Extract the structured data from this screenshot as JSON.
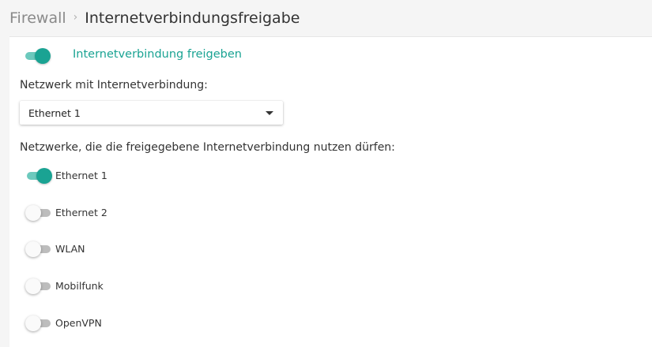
{
  "breadcrumb": {
    "parent": "Firewall",
    "separator": "›",
    "current": "Internetverbindungsfreigabe"
  },
  "sharing": {
    "toggle_label": "Internetverbindung freigeben",
    "enabled": true
  },
  "source_network": {
    "label": "Netzwerk mit Internetverbindung:",
    "selected": "Ethernet 1"
  },
  "allowed_networks": {
    "label": "Netzwerke, die die freigegebene Internetverbindung nutzen dürfen:",
    "items": [
      {
        "name": "Ethernet 1",
        "enabled": true
      },
      {
        "name": "Ethernet 2",
        "enabled": false
      },
      {
        "name": "WLAN",
        "enabled": false
      },
      {
        "name": "Mobilfunk",
        "enabled": false
      },
      {
        "name": "OpenVPN",
        "enabled": false
      }
    ]
  },
  "colors": {
    "accent": "#1aa393",
    "accent_track": "#6cc9bd",
    "off_track": "#bdbdbd",
    "off_knob": "#fafafa"
  }
}
